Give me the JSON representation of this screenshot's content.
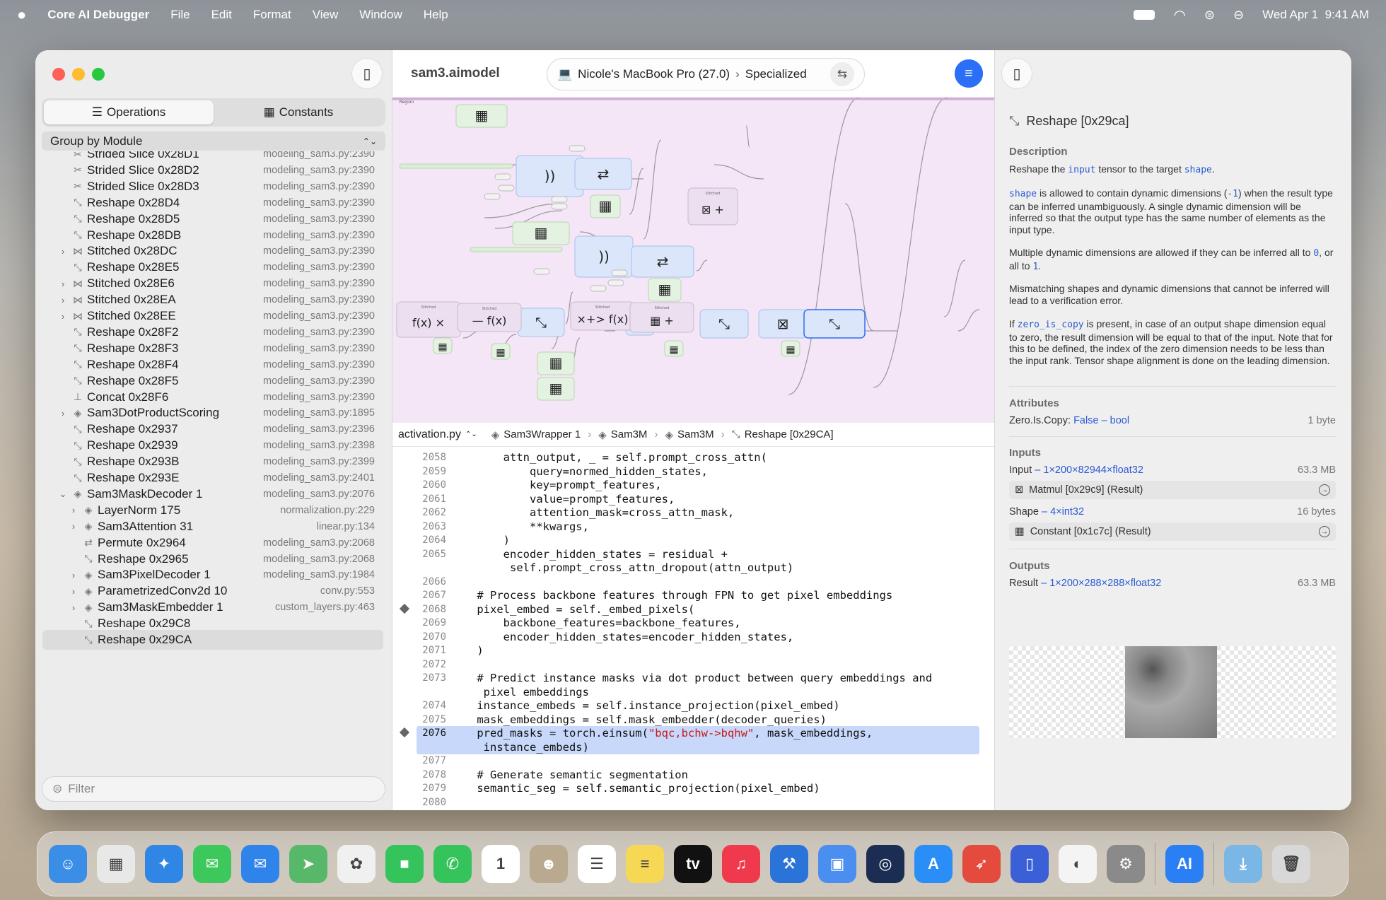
{
  "menubar": {
    "app_name": "Core AI Debugger",
    "items": [
      "File",
      "Edit",
      "Format",
      "View",
      "Window",
      "Help"
    ],
    "datetime": "Wed Apr 1  9:41 AM"
  },
  "sidebar": {
    "tabs": [
      {
        "label": "Operations"
      },
      {
        "label": "Constants"
      }
    ],
    "group_by": "Group by Module",
    "filter_placeholder": "Filter",
    "operations": [
      {
        "name": "Strided Slice 0x28D1",
        "src": "modeling_sam3.py:2390",
        "lvl": 0,
        "icon": "slice",
        "exp": false
      },
      {
        "name": "Strided Slice 0x28D2",
        "src": "modeling_sam3.py:2390",
        "lvl": 0,
        "icon": "slice",
        "exp": false
      },
      {
        "name": "Strided Slice 0x28D3",
        "src": "modeling_sam3.py:2390",
        "lvl": 0,
        "icon": "slice",
        "exp": false
      },
      {
        "name": "Reshape 0x28D4",
        "src": "modeling_sam3.py:2390",
        "lvl": 0,
        "icon": "reshape",
        "exp": false
      },
      {
        "name": "Reshape 0x28D5",
        "src": "modeling_sam3.py:2390",
        "lvl": 0,
        "icon": "reshape",
        "exp": false
      },
      {
        "name": "Reshape 0x28DB",
        "src": "modeling_sam3.py:2390",
        "lvl": 0,
        "icon": "reshape",
        "exp": false
      },
      {
        "name": "Stitched 0x28DC",
        "src": "modeling_sam3.py:2390",
        "lvl": 0,
        "icon": "stitched",
        "exp": true
      },
      {
        "name": "Reshape 0x28E5",
        "src": "modeling_sam3.py:2390",
        "lvl": 0,
        "icon": "reshape",
        "exp": false
      },
      {
        "name": "Stitched 0x28E6",
        "src": "modeling_sam3.py:2390",
        "lvl": 0,
        "icon": "stitched",
        "exp": true
      },
      {
        "name": "Stitched 0x28EA",
        "src": "modeling_sam3.py:2390",
        "lvl": 0,
        "icon": "stitched",
        "exp": true
      },
      {
        "name": "Stitched 0x28EE",
        "src": "modeling_sam3.py:2390",
        "lvl": 0,
        "icon": "stitched",
        "exp": true
      },
      {
        "name": "Reshape 0x28F2",
        "src": "modeling_sam3.py:2390",
        "lvl": 0,
        "icon": "reshape",
        "exp": false
      },
      {
        "name": "Reshape 0x28F3",
        "src": "modeling_sam3.py:2390",
        "lvl": 0,
        "icon": "reshape",
        "exp": false
      },
      {
        "name": "Reshape 0x28F4",
        "src": "modeling_sam3.py:2390",
        "lvl": 0,
        "icon": "reshape",
        "exp": false
      },
      {
        "name": "Reshape 0x28F5",
        "src": "modeling_sam3.py:2390",
        "lvl": 0,
        "icon": "reshape",
        "exp": false
      },
      {
        "name": "Concat 0x28F6",
        "src": "modeling_sam3.py:2390",
        "lvl": 0,
        "icon": "concat",
        "exp": false
      },
      {
        "name": "Sam3DotProductScoring",
        "src": "modeling_sam3.py:1895",
        "lvl": 0,
        "icon": "module",
        "exp": true
      },
      {
        "name": "Reshape 0x2937",
        "src": "modeling_sam3.py:2396",
        "lvl": 0,
        "icon": "reshape",
        "exp": false
      },
      {
        "name": "Reshape 0x2939",
        "src": "modeling_sam3.py:2398",
        "lvl": 0,
        "icon": "reshape",
        "exp": false
      },
      {
        "name": "Reshape 0x293B",
        "src": "modeling_sam3.py:2399",
        "lvl": 0,
        "icon": "reshape",
        "exp": false
      },
      {
        "name": "Reshape 0x293E",
        "src": "modeling_sam3.py:2401",
        "lvl": 0,
        "icon": "reshape",
        "exp": false
      },
      {
        "name": "Sam3MaskDecoder 1",
        "src": "modeling_sam3.py:2076",
        "lvl": 0,
        "icon": "module",
        "exp": "open"
      },
      {
        "name": "LayerNorm 175",
        "src": "normalization.py:229",
        "lvl": 1,
        "icon": "module",
        "exp": true
      },
      {
        "name": "Sam3Attention 31",
        "src": "linear.py:134",
        "lvl": 1,
        "icon": "module",
        "exp": true
      },
      {
        "name": "Permute 0x2964",
        "src": "modeling_sam3.py:2068",
        "lvl": 1,
        "icon": "permute",
        "exp": false
      },
      {
        "name": "Reshape 0x2965",
        "src": "modeling_sam3.py:2068",
        "lvl": 1,
        "icon": "reshape",
        "exp": false
      },
      {
        "name": "Sam3PixelDecoder 1",
        "src": "modeling_sam3.py:1984",
        "lvl": 1,
        "icon": "module",
        "exp": true
      },
      {
        "name": "ParametrizedConv2d 10",
        "src": "conv.py:553",
        "lvl": 1,
        "icon": "module",
        "exp": true
      },
      {
        "name": "Sam3MaskEmbedder 1",
        "src": "custom_layers.py:463",
        "lvl": 1,
        "icon": "module",
        "exp": true
      },
      {
        "name": "Reshape 0x29C8",
        "src": "",
        "lvl": 1,
        "icon": "reshape",
        "exp": false
      },
      {
        "name": "Reshape 0x29CA",
        "src": "",
        "lvl": 1,
        "icon": "reshape",
        "exp": false,
        "selected": true
      }
    ]
  },
  "toolbar": {
    "doc_title": "sam3.aimodel",
    "device": "Nicole's MacBook Pro (27.0)",
    "mode": "Specialized"
  },
  "graph": {
    "region_label": "Region",
    "stitched_label": "Stitched"
  },
  "breadcrumb": {
    "file": "activation.py",
    "items": [
      "Sam3Wrapper 1",
      "Sam3M",
      "Sam3M",
      "Reshape [0x29CA]"
    ]
  },
  "code": [
    {
      "n": "2058",
      "t": "        attn_output, _ = self.prompt_cross_attn("
    },
    {
      "n": "2059",
      "t": "            query=normed_hidden_states,"
    },
    {
      "n": "2060",
      "t": "            key=prompt_features,"
    },
    {
      "n": "2061",
      "t": "            value=prompt_features,"
    },
    {
      "n": "2062",
      "t": "            attention_mask=cross_attn_mask,"
    },
    {
      "n": "2063",
      "t": "            **kwargs,"
    },
    {
      "n": "2064",
      "t": "        )"
    },
    {
      "n": "2065",
      "t": "        encoder_hidden_states = residual +"
    },
    {
      "n": "",
      "t": "         self.prompt_cross_attn_dropout(attn_output)"
    },
    {
      "n": "2066",
      "t": ""
    },
    {
      "n": "2067",
      "t": "    # Process backbone features through FPN to get pixel embeddings",
      "c": 1
    },
    {
      "n": "2068",
      "t": "    pixel_embed = self._embed_pixels(",
      "bp": 1
    },
    {
      "n": "2069",
      "t": "        backbone_features=backbone_features,"
    },
    {
      "n": "2070",
      "t": "        encoder_hidden_states=encoder_hidden_states,"
    },
    {
      "n": "2071",
      "t": "    )"
    },
    {
      "n": "2072",
      "t": ""
    },
    {
      "n": "2073",
      "t": "    # Predict instance masks via dot product between query embeddings and",
      "c": 1
    },
    {
      "n": "",
      "t": "     pixel embeddings",
      "c": 1
    },
    {
      "n": "2074",
      "t": "    instance_embeds = self.instance_projection(pixel_embed)"
    },
    {
      "n": "2075",
      "t": "    mask_embeddings = self.mask_embedder(decoder_queries)"
    },
    {
      "n": "2076",
      "pre": "    pred_masks = torch.einsum(",
      "str": "\"bqc,bchw->bqhw\"",
      "post": ", mask_embeddings,",
      "bp": 1,
      "hl": 1
    },
    {
      "n": "",
      "t": "     instance_embeds)"
    },
    {
      "n": "2077",
      "t": ""
    },
    {
      "n": "2078",
      "t": "    # Generate semantic segmentation",
      "c": 1
    },
    {
      "n": "2079",
      "t": "    semantic_seg = self.semantic_projection(pixel_embed)"
    },
    {
      "n": "2080",
      "t": ""
    }
  ],
  "inspector": {
    "title": "Reshape [0x29ca]",
    "description_h": "Description",
    "desc": {
      "p1a": "Reshape the ",
      "p1k1": "input",
      "p1b": " tensor to the target ",
      "p1k2": "shape",
      "p1c": ".",
      "p2k": "shape",
      "p2a": " is allowed to contain dynamic dimensions (",
      "p2k2": "-1",
      "p2b": ") when the result type can be inferred unambiguously. A single dynamic dimension will be inferred so that the output type has the same number of elements as the input type.",
      "p3a": "Multiple dynamic dimensions are allowed if they can be inferred all to ",
      "p3k": "0",
      "p3b": ", or all to ",
      "p3k2": "1",
      "p3c": ".",
      "p4": "Mismatching shapes and dynamic dimensions that cannot be inferred will lead to a verification error.",
      "p5a": "If ",
      "p5k": "zero_is_copy",
      "p5b": " is present, in case of an output shape dimension equal to zero, the result dimension will be equal to that of the input. Note that for this to be defined, the index of the zero dimension needs to be less than the input rank. Tensor shape alignment is done on the leading dimension."
    },
    "attributes_h": "Attributes",
    "attr": {
      "name": "Zero.Is.Copy:",
      "value": "False",
      "type": "bool",
      "size": "1 byte"
    },
    "inputs_h": "Inputs",
    "input1": {
      "label": "Input",
      "type": "1×200×82944×float32",
      "size": "63.3 MB",
      "source": "Matmul [0x29c9] (Result)"
    },
    "input2": {
      "label": "Shape",
      "type": "4×int32",
      "size": "16 bytes",
      "source": "Constant [0x1c7c] (Result)"
    },
    "outputs_h": "Outputs",
    "output1": {
      "label": "Result",
      "type": "1×200×288×288×float32",
      "size": "63.3 MB"
    }
  },
  "dock": {
    "apps": [
      {
        "name": "Finder",
        "color": "#3a8ee6",
        "glyph": "☺"
      },
      {
        "name": "Launchpad",
        "color": "#e8e8e8",
        "glyph": "▦"
      },
      {
        "name": "Safari",
        "color": "#2f86e4",
        "glyph": "✦"
      },
      {
        "name": "Messages",
        "color": "#3cc85a",
        "glyph": "✉"
      },
      {
        "name": "Mail",
        "color": "#2f84ec",
        "glyph": "✉"
      },
      {
        "name": "Maps",
        "color": "#58b86a",
        "glyph": "➤"
      },
      {
        "name": "Photos",
        "color": "#f0f0f0",
        "glyph": "✿"
      },
      {
        "name": "FaceTime",
        "color": "#35c35c",
        "glyph": "■"
      },
      {
        "name": "Phone",
        "color": "#35c35c",
        "glyph": "✆"
      },
      {
        "name": "Calendar",
        "color": "#ffffff",
        "glyph": "1"
      },
      {
        "name": "Contacts",
        "color": "#b8a98f",
        "glyph": "☻"
      },
      {
        "name": "Reminders",
        "color": "#ffffff",
        "glyph": "☰"
      },
      {
        "name": "Notes",
        "color": "#f6d855",
        "glyph": "≡"
      },
      {
        "name": "TV",
        "color": "#111111",
        "glyph": "tv"
      },
      {
        "name": "Music",
        "color": "#f0394d",
        "glyph": "♫"
      },
      {
        "name": "Xcode",
        "color": "#2a73d8",
        "glyph": "⚒"
      },
      {
        "name": "Screen Sharing",
        "color": "#4a8ef0",
        "glyph": "▣"
      },
      {
        "name": "Instruments",
        "color": "#1b2d52",
        "glyph": "◎"
      },
      {
        "name": "App Store",
        "color": "#2a8ef6",
        "glyph": "A"
      },
      {
        "name": "Rocket",
        "color": "#e54b3c",
        "glyph": "➶"
      },
      {
        "name": "Simulator",
        "color": "#3b5fd6",
        "glyph": "▯"
      },
      {
        "name": "Console",
        "color": "#f4f4f4",
        "glyph": "◐"
      },
      {
        "name": "System Settings",
        "color": "#8a8a8a",
        "glyph": "⚙"
      },
      {
        "name": "Core AI Debugger",
        "color": "#2a7ff4",
        "glyph": "AI"
      },
      {
        "name": "Downloads",
        "color": "#7bb7e6",
        "glyph": "⤓"
      },
      {
        "name": "Trash",
        "color": "#d8d8d8",
        "glyph": "🗑"
      }
    ]
  },
  "colors": {
    "accent": "#2a6ff5",
    "graph_bg": "#f4e6f6",
    "node_blue": "#dbe6fb",
    "node_green": "#e4f3e1",
    "selection": "#c8d8fb"
  }
}
